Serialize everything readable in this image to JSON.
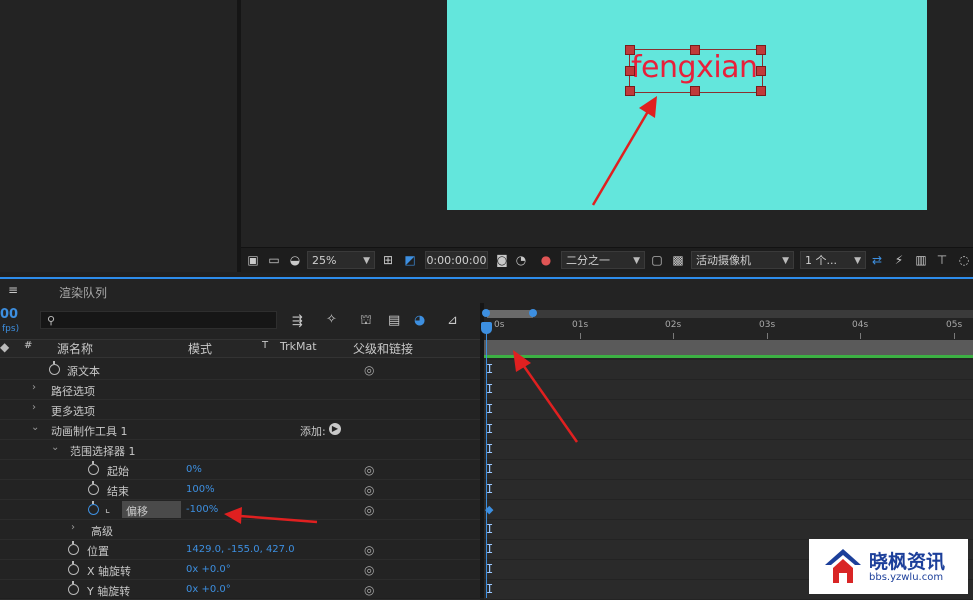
{
  "composition": {
    "text": "fengxian",
    "bg_color": "#63e6dc",
    "text_color": "#e8203a"
  },
  "viewer_toolbar": {
    "zoom": "25%",
    "timecode": "0:00:00:00",
    "resolution": "二分之一",
    "camera": "活动摄像机",
    "views": "1 个..."
  },
  "timeline": {
    "panel_menu_icon": "≡",
    "tab_label": "渲染队列",
    "time_fragment": "00",
    "fps_fragment": "fps)",
    "search_placeholder": "",
    "columns": {
      "source_name": "源名称",
      "mode": "模式",
      "t": "T",
      "trkmat": "TrkMat",
      "parent": "父级和链接",
      "hash": "#"
    },
    "ruler": [
      "0s",
      "01s",
      "02s",
      "03s",
      "04s",
      "05s"
    ],
    "rows": [
      {
        "label": "源文本"
      },
      {
        "label": "路径选项"
      },
      {
        "label": "更多选项"
      },
      {
        "label": "动画制作工具 1",
        "add_label": "添加:"
      },
      {
        "label": "范围选择器 1"
      },
      {
        "label": "起始",
        "value": "0%"
      },
      {
        "label": "结束",
        "value": "100%"
      },
      {
        "label": "偏移",
        "value": "-100%"
      },
      {
        "label": "高级"
      },
      {
        "label": "位置",
        "value": "1429.0, -155.0, 427.0"
      },
      {
        "label": "X 轴旋转",
        "value": "0x +0.0°"
      },
      {
        "label": "Y 轴旋转",
        "value": "0x +0.0°"
      }
    ]
  },
  "watermark": {
    "brand": "晓枫资讯",
    "url": "bbs.yzwlu.com"
  },
  "colors": {
    "accent": "#2d8ceb",
    "value_blue": "#3d8fe0",
    "annotation_red": "#e02020",
    "work_area_green": "#3cb043"
  }
}
